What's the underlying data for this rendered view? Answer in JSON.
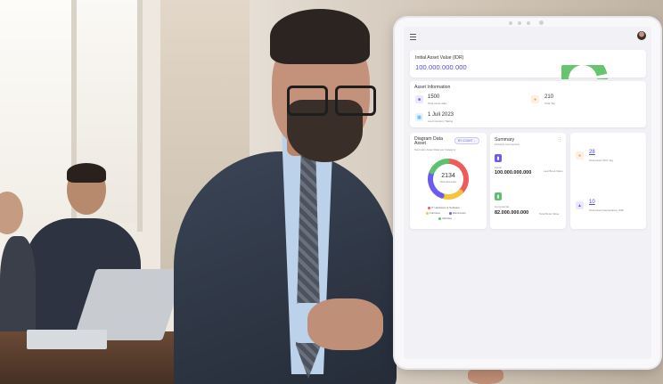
{
  "dashboard": {
    "initial_asset": {
      "title": "Initial Asset Value (IDR)",
      "value": "100.000.000.000"
    },
    "asset_information": {
      "title": "Asset Information",
      "items": [
        {
          "value": "1500",
          "label": "Total asset data",
          "icon": "box-icon",
          "color": "#7b5cf0"
        },
        {
          "value": "210",
          "label": "Total Tag",
          "icon": "tag-icon",
          "color": "#f1a25a"
        },
        {
          "value": "1 Juli 2023",
          "label": "Last inventory Taking",
          "icon": "calendar-icon",
          "color": "#48a8e8"
        }
      ]
    },
    "diagram": {
      "title": "Diagram Data Asset",
      "subtitle": "Summary Asset Data per Category",
      "filter_label": "BY COUNT",
      "total": "2134",
      "total_label": "Total Data Asset",
      "legend": [
        {
          "label": "IT Hardware & Software",
          "color": "#ef5a5a"
        },
        {
          "label": "Furniture",
          "color": "#f5c542"
        },
        {
          "label": "Electronics",
          "color": "#6a5cf0"
        },
        {
          "label": "Vehicles",
          "color": "#5cc26b"
        }
      ]
    },
    "chart_data": {
      "type": "pie",
      "center_value": 2134,
      "slices": [
        {
          "label": "IT Hardware & Software",
          "value": 0.38,
          "color": "#ef5a5a"
        },
        {
          "label": "Furniture",
          "value": 0.18,
          "color": "#f5c542"
        },
        {
          "label": "Electronics",
          "value": 0.26,
          "color": "#6a5cf0"
        },
        {
          "label": "Vehicles",
          "value": 0.18,
          "color": "#5cc26b"
        }
      ]
    },
    "summary": {
      "title": "Summary",
      "subtitle": "Fiscal & Commercial",
      "more_icon": "more-vertical-icon",
      "fiscal": {
        "label": "Fiscal",
        "value": "100.000.000.000",
        "note": "Last Book Value"
      },
      "commercial": {
        "label": "Commercial",
        "value": "82.000.000.000",
        "note": "Total Book Value"
      }
    },
    "stats": {
      "tags": {
        "value": "28",
        "label": "Total Asset W/O Tag",
        "icon": "tag-icon"
      },
      "depreciation": {
        "value": "10",
        "label": "Total Asset Depreciation W/B",
        "icon": "chart-icon"
      }
    },
    "colors": {
      "accent": "#4b4bd8",
      "gauge": "#68c46f"
    }
  }
}
